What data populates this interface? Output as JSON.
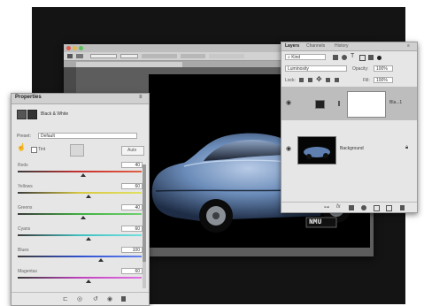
{
  "ps_window": {
    "title": "",
    "tab_label": ""
  },
  "properties": {
    "title": "Properties",
    "adjustment_name": "Black & White",
    "preset_label": "Preset:",
    "preset_value": "Default",
    "tint_label": "Tint",
    "auto_label": "Auto",
    "sliders": [
      {
        "label": "Reds",
        "value": "40",
        "level": 0.53,
        "gradient": "linear-gradient(90deg,#3a3a3a,#c83030,#e06040)"
      },
      {
        "label": "Yellows",
        "value": "60",
        "level": 0.57,
        "gradient": "linear-gradient(90deg,#3a3a3a,#d8c840,#e0e060)"
      },
      {
        "label": "Greens",
        "value": "40",
        "level": 0.53,
        "gradient": "linear-gradient(90deg,#3a3a3a,#40b040,#70d070)"
      },
      {
        "label": "Cyans",
        "value": "60",
        "level": 0.57,
        "gradient": "linear-gradient(90deg,#3a3a3a,#40c0c0,#70e0e0)"
      },
      {
        "label": "Blues",
        "value": "100",
        "level": 0.67,
        "gradient": "linear-gradient(90deg,#3a3a3a,#3050d0,#6080f0)"
      },
      {
        "label": "Magentas",
        "value": "60",
        "level": 0.57,
        "gradient": "linear-gradient(90deg,#3a3a3a,#c040c0,#e070e0)"
      }
    ],
    "footer_icons": [
      "clip-to-layer-icon",
      "view-previous-icon",
      "reset-icon",
      "visibility-icon",
      "trash-icon"
    ]
  },
  "layers": {
    "tabs": [
      "Layers",
      "Channels",
      "History"
    ],
    "active_tab": "Layers",
    "filter_label": "Kind",
    "blend_mode": "Luminosity",
    "opacity_label": "Opacity:",
    "opacity_value": "100%",
    "lock_label": "Lock:",
    "fill_label": "Fill:",
    "fill_value": "100%",
    "items": [
      {
        "name": "Bla...1",
        "type": "adjustment",
        "selected": true
      },
      {
        "name": "Background",
        "type": "image",
        "selected": false
      }
    ]
  },
  "photo": {
    "plate_text": "NMU"
  },
  "colors": {
    "panel_bg": "#e6e6e6",
    "backdrop": "#141414",
    "car_blue": "#6a8bb8"
  }
}
